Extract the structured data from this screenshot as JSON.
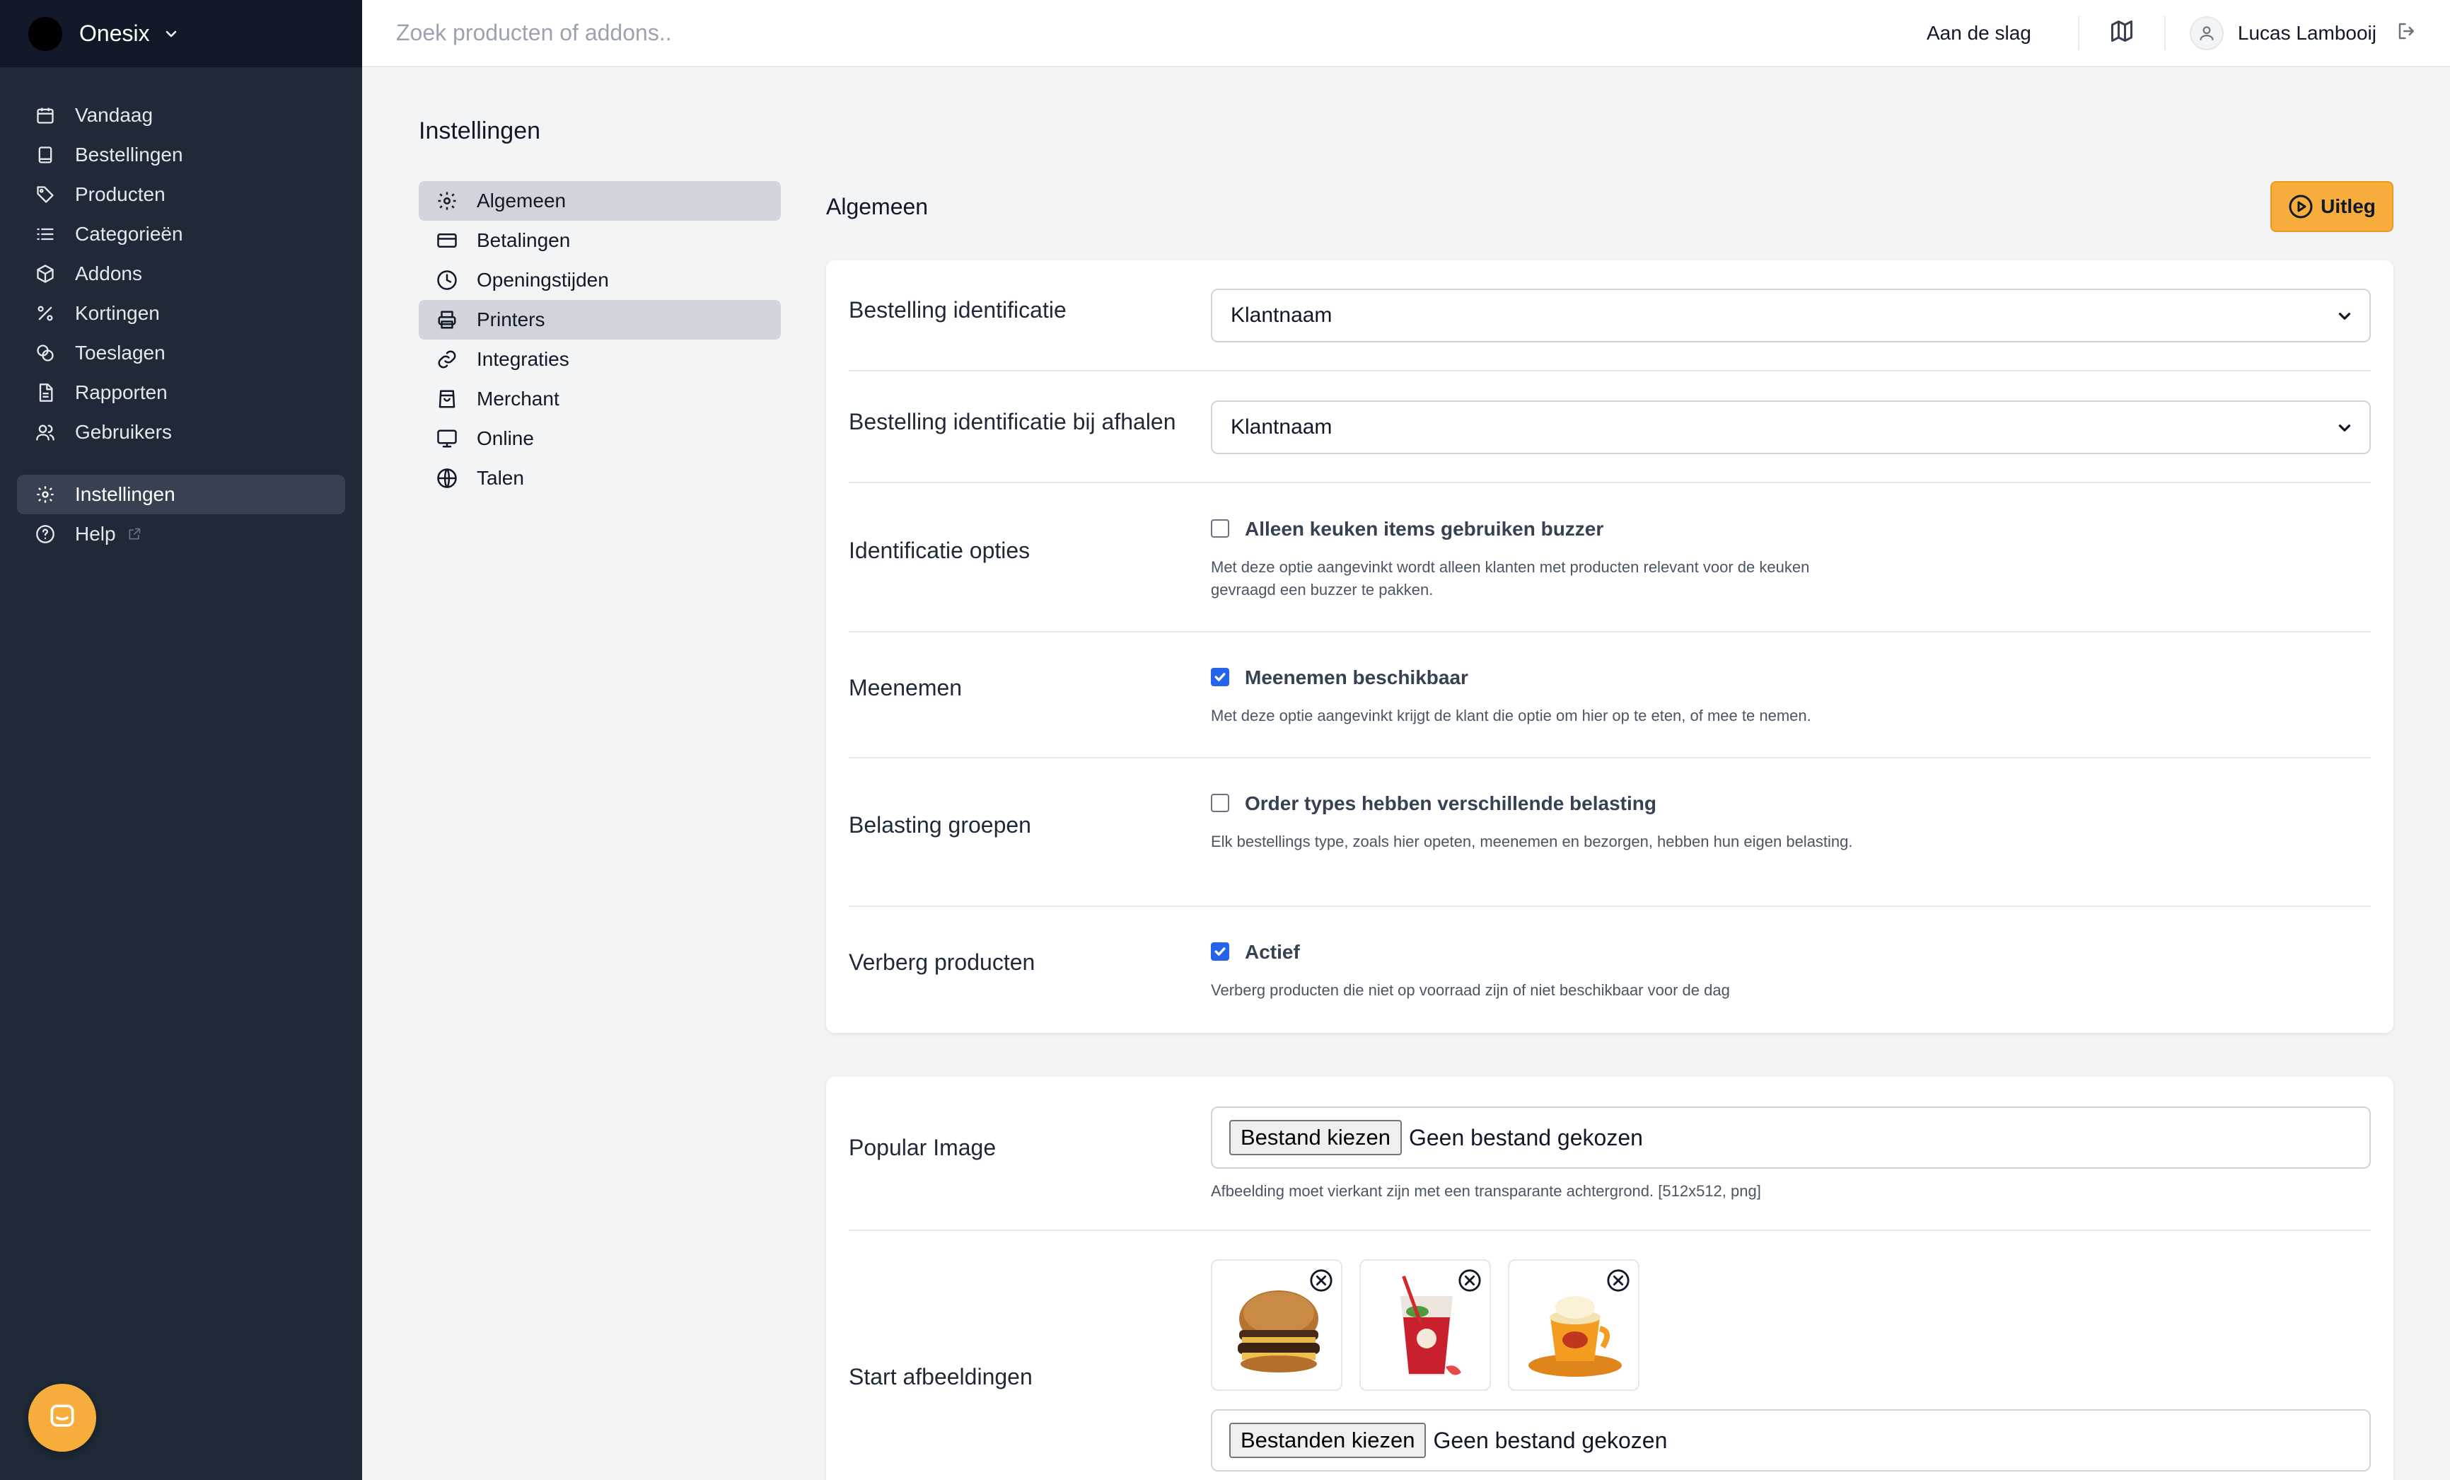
{
  "app": {
    "name": "Onesix"
  },
  "sidebar": {
    "items": [
      {
        "label": "Vandaag",
        "icon": "calendar-icon"
      },
      {
        "label": "Bestellingen",
        "icon": "book-icon"
      },
      {
        "label": "Producten",
        "icon": "tag-icon"
      },
      {
        "label": "Categorieën",
        "icon": "list-icon"
      },
      {
        "label": "Addons",
        "icon": "cube-icon"
      },
      {
        "label": "Kortingen",
        "icon": "percent-icon"
      },
      {
        "label": "Toeslagen",
        "icon": "coins-icon"
      },
      {
        "label": "Rapporten",
        "icon": "document-icon"
      },
      {
        "label": "Gebruikers",
        "icon": "users-icon"
      }
    ],
    "settings_label": "Instellingen",
    "help_label": "Help"
  },
  "topbar": {
    "search_placeholder": "Zoek producten of addons..",
    "start_link": "Aan de slag",
    "user_name": "Lucas Lambooij"
  },
  "page": {
    "title": "Instellingen"
  },
  "subnav": {
    "items": [
      {
        "label": "Algemeen",
        "icon": "gear-icon"
      },
      {
        "label": "Betalingen",
        "icon": "credit-card-icon"
      },
      {
        "label": "Openingstijden",
        "icon": "clock-icon"
      },
      {
        "label": "Printers",
        "icon": "printer-icon"
      },
      {
        "label": "Integraties",
        "icon": "link-icon"
      },
      {
        "label": "Merchant",
        "icon": "shopping-bag-icon"
      },
      {
        "label": "Online",
        "icon": "monitor-icon"
      },
      {
        "label": "Talen",
        "icon": "globe-icon"
      }
    ]
  },
  "section": {
    "title": "Algemeen",
    "uitleg_label": "Uitleg"
  },
  "form": {
    "bestelling_identificatie": {
      "label": "Bestelling identificatie",
      "value": "Klantnaam"
    },
    "bestelling_afhalen": {
      "label": "Bestelling identificatie bij afhalen",
      "value": "Klantnaam"
    },
    "identificatie_opties": {
      "label": "Identificatie opties",
      "check_label": "Alleen keuken items gebruiken buzzer",
      "checked": false,
      "help": "Met deze optie aangevinkt wordt alleen klanten met producten relevant voor de keuken gevraagd een buzzer te pakken."
    },
    "meenemen": {
      "label": "Meenemen",
      "check_label": "Meenemen beschikbaar",
      "checked": true,
      "help": "Met deze optie aangevinkt krijgt de klant die optie om hier op te eten, of mee te nemen."
    },
    "belasting": {
      "label": "Belasting groepen",
      "check_label": "Order types hebben verschillende belasting",
      "checked": false,
      "help": "Elk bestellings type, zoals hier opeten, meenemen en bezorgen, hebben hun eigen belasting."
    },
    "verberg": {
      "label": "Verberg producten",
      "check_label": "Actief",
      "checked": true,
      "help": "Verberg producten die niet op voorraad zijn of niet beschikbaar voor de dag"
    }
  },
  "media": {
    "popular_image": {
      "label": "Popular Image",
      "button": "Bestand kiezen",
      "status": "Geen bestand gekozen",
      "help": "Afbeelding moet vierkant zijn met een transparante achtergrond. [512x512, png]"
    },
    "start_images": {
      "label": "Start afbeeldingen",
      "button": "Bestanden kiezen",
      "status": "Geen bestand gekozen"
    }
  },
  "colors": {
    "sidebar": "#1f2937",
    "brand_bar": "#111827",
    "accent": "#f6ad3b",
    "checkbox": "#2563eb"
  }
}
